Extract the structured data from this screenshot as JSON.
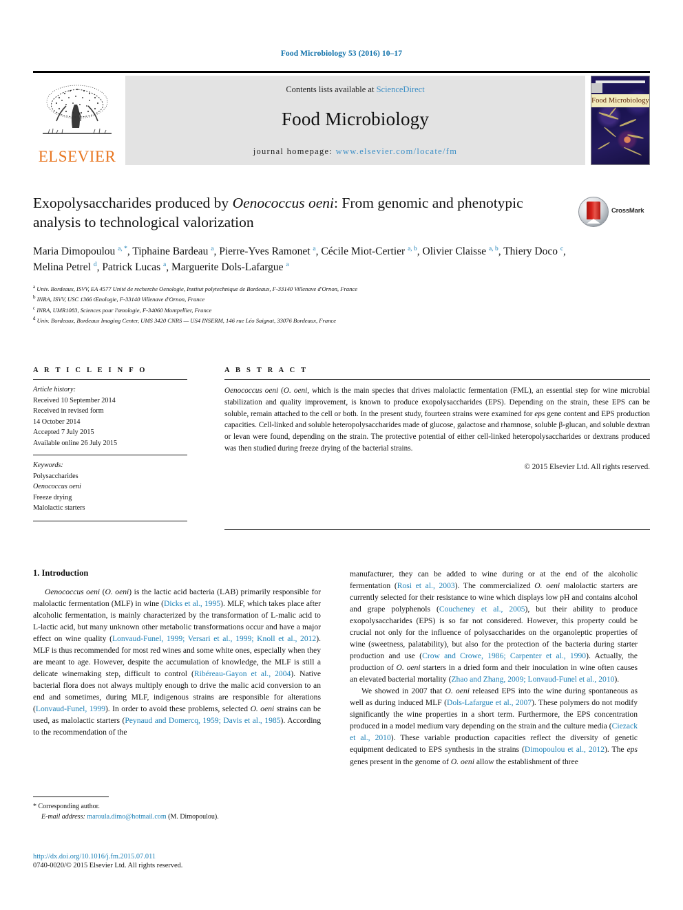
{
  "running_head": "Food Microbiology 53 (2016) 10–17",
  "masthead": {
    "publisher_wordmark": "ELSEVIER",
    "contents_prefix": "Contents lists available at ",
    "contents_link": "ScienceDirect",
    "journal_title": "Food Microbiology",
    "homepage_label": "journal homepage: ",
    "homepage_url": "www.elsevier.com/locate/fm",
    "cover_band_text": "Food Microbiology"
  },
  "article": {
    "title_part1": "Exopolysaccharides produced by ",
    "title_italic": "Oenococcus oeni",
    "title_part2": ": From genomic and phenotypic analysis to technological valorization",
    "crossmark_label": "CrossMark",
    "authors": [
      {
        "name": "Maria Dimopoulou",
        "marks": "a, *"
      },
      {
        "name": "Tiphaine Bardeau",
        "marks": "a"
      },
      {
        "name": "Pierre-Yves Ramonet",
        "marks": "a"
      },
      {
        "name": "Cécile Miot-Certier",
        "marks": "a, b"
      },
      {
        "name": "Olivier Claisse",
        "marks": "a, b"
      },
      {
        "name": "Thiery Doco",
        "marks": "c"
      },
      {
        "name": "Melina Petrel",
        "marks": "d"
      },
      {
        "name": "Patrick Lucas",
        "marks": "a"
      },
      {
        "name": "Marguerite Dols-Lafargue",
        "marks": "a"
      }
    ],
    "affiliations": [
      {
        "mark": "a",
        "text": "Univ. Bordeaux, ISVV, EA 4577 Unité de recherche Oenologie, Institut polytechnique de Bordeaux, F-33140 Villenave d'Ornon, France"
      },
      {
        "mark": "b",
        "text": "INRA, ISVV, USC 1366 Œnologie, F-33140 Villenave d'Ornon, France"
      },
      {
        "mark": "c",
        "text": "INRA, UMR1083, Sciences pour l'œnologie, F-34060 Montpellier, France"
      },
      {
        "mark": "d",
        "text": "Univ. Bordeaux, Bordeaux Imaging Center, UMS 3420 CNRS — US4 INSERM, 146 rue Léo Saignat, 33076 Bordeaux, France"
      }
    ]
  },
  "article_info": {
    "heading": "A R T I C L E  I N F O",
    "history_label": "Article history:",
    "history_lines": [
      "Received 10 September 2014",
      "Received in revised form",
      "14 October 2014",
      "Accepted 7 July 2015",
      "Available online 26 July 2015"
    ],
    "keywords_label": "Keywords:",
    "keywords": [
      {
        "text": "Polysaccharides",
        "italic": false
      },
      {
        "text": "Oenococcus oeni",
        "italic": true
      },
      {
        "text": "Freeze drying",
        "italic": false
      },
      {
        "text": "Malolactic starters",
        "italic": false
      }
    ]
  },
  "abstract": {
    "heading": "A B S T R A C T",
    "lead_italic": "Oenococcus oeni",
    "lead_paren_italic": "O. oeni",
    "text_after_lead": ", which is the main species that drives malolactic fermentation (FML), an essential step for wine microbial stabilization and quality improvement, is known to produce exopolysaccharides (EPS). Depending on the strain, these EPS can be soluble, remain attached to the cell or both. In the present study, fourteen strains were examined for ",
    "eps_italic": "eps",
    "text_tail": " gene content and EPS production capacities. Cell-linked and soluble heteropolysaccharides made of glucose, galactose and rhamnose, soluble β-glucan, and soluble dextran or levan were found, depending on the strain. The protective potential of either cell-linked heteropolysaccharides or dextrans produced was then studied during freeze drying of the bacterial strains.",
    "copyright": "© 2015 Elsevier Ltd. All rights reserved."
  },
  "introduction": {
    "heading": "1. Introduction",
    "left_paragraph_1": {
      "lead_italic": "Oenococcus oeni",
      "lead_paren": "O. oeni",
      "segments": [
        {
          "t": " is the lactic acid bacteria (LAB) primarily responsible for malolactic fermentation (MLF) in wine ("
        },
        {
          "t": "Dicks et al., 1995",
          "cite": true
        },
        {
          "t": "). MLF, which takes place after alcoholic fermentation, is mainly characterized by the transformation of "
        },
        {
          "t": "L",
          "sc": true
        },
        {
          "t": "-malic acid to "
        },
        {
          "t": "L",
          "sc": true
        },
        {
          "t": "-lactic acid, but many unknown other metabolic transformations occur and have a major effect on wine quality ("
        },
        {
          "t": "Lonvaud-Funel, 1999; Versari et al., 1999; Knoll et al., 2012",
          "cite": true
        },
        {
          "t": "). MLF is thus recommended for most red wines and some white ones, especially when they are meant to age. However, despite the accumulation of knowledge, the MLF is still a delicate winemaking step, difficult to control ("
        },
        {
          "t": "Ribéreau-Gayon et al., 2004",
          "cite": true
        },
        {
          "t": "). Native bacterial flora does not always multiply enough to drive the malic acid conversion to an end and sometimes, during MLF, indigenous strains are responsible for alterations ("
        },
        {
          "t": "Lonvaud-Funel, 1999",
          "cite": true
        },
        {
          "t": "). In order to avoid these problems, selected "
        },
        {
          "t": "O. oeni",
          "ital": true
        },
        {
          "t": " strains can be used, as malolactic starters ("
        },
        {
          "t": "Peynaud and Domercq, 1959; Davis et al., 1985",
          "cite": true
        },
        {
          "t": "). According to the recommendation of the"
        }
      ]
    },
    "right_paragraph_1": [
      {
        "t": "manufacturer, they can be added to wine during or at the end of the alcoholic fermentation ("
      },
      {
        "t": "Rosi et al., 2003",
        "cite": true
      },
      {
        "t": "). The commercialized "
      },
      {
        "t": "O. oeni",
        "ital": true
      },
      {
        "t": " malolactic starters are currently selected for their resistance to wine which displays low pH and contains alcohol and grape polyphenols ("
      },
      {
        "t": "Coucheney et al., 2005",
        "cite": true
      },
      {
        "t": "), but their ability to produce exopolysaccharides (EPS) is so far not considered. However, this property could be crucial not only for the influence of polysaccharides on the organoleptic properties of wine (sweetness, palatability), but also for the protection of the bacteria during starter production and use ("
      },
      {
        "t": "Crow and Crowe, 1986; Carpenter et al., 1990",
        "cite": true
      },
      {
        "t": "). Actually, the production of "
      },
      {
        "t": "O. oeni",
        "ital": true
      },
      {
        "t": " starters in a dried form and their inoculation in wine often causes an elevated bacterial mortality ("
      },
      {
        "t": "Zhao and Zhang, 2009; Lonvaud-Funel et al., 2010",
        "cite": true
      },
      {
        "t": ")."
      }
    ],
    "right_paragraph_2": [
      {
        "t": "We showed in 2007 that "
      },
      {
        "t": "O. oeni",
        "ital": true
      },
      {
        "t": " released EPS into the wine during spontaneous as well as during induced MLF ("
      },
      {
        "t": "Dols-Lafargue et al., 2007",
        "cite": true
      },
      {
        "t": "). These polymers do not modify significantly the wine properties in a short term. Furthermore, the EPS concentration produced in a model medium vary depending on the strain and the culture media ("
      },
      {
        "t": "Ciezack et al., 2010",
        "cite": true
      },
      {
        "t": "). These variable production capacities reflect the diversity of genetic equipment dedicated to EPS synthesis in the strains ("
      },
      {
        "t": "Dimopoulou et al., 2012",
        "cite": true
      },
      {
        "t": "). The "
      },
      {
        "t": "eps",
        "ital": true
      },
      {
        "t": " genes present in the genome of "
      },
      {
        "t": "O. oeni",
        "ital": true
      },
      {
        "t": " allow the establishment of three"
      }
    ]
  },
  "footnote": {
    "corresponding_marker": "*",
    "corresponding_text": "Corresponding author.",
    "email_label": "E-mail address:",
    "email": "maroula.dimo@hotmail.com",
    "email_owner": "(M. Dimopoulou)."
  },
  "publication": {
    "doi": "http://dx.doi.org/10.1016/j.fm.2015.07.011",
    "issn_line": "0740-0020/© 2015 Elsevier Ltd. All rights reserved."
  },
  "colors": {
    "link": "#1b7fb5",
    "running_head": "#0b6ea8",
    "elsevier_orange": "#E87722",
    "banner_gray": "#e3e3e3"
  }
}
